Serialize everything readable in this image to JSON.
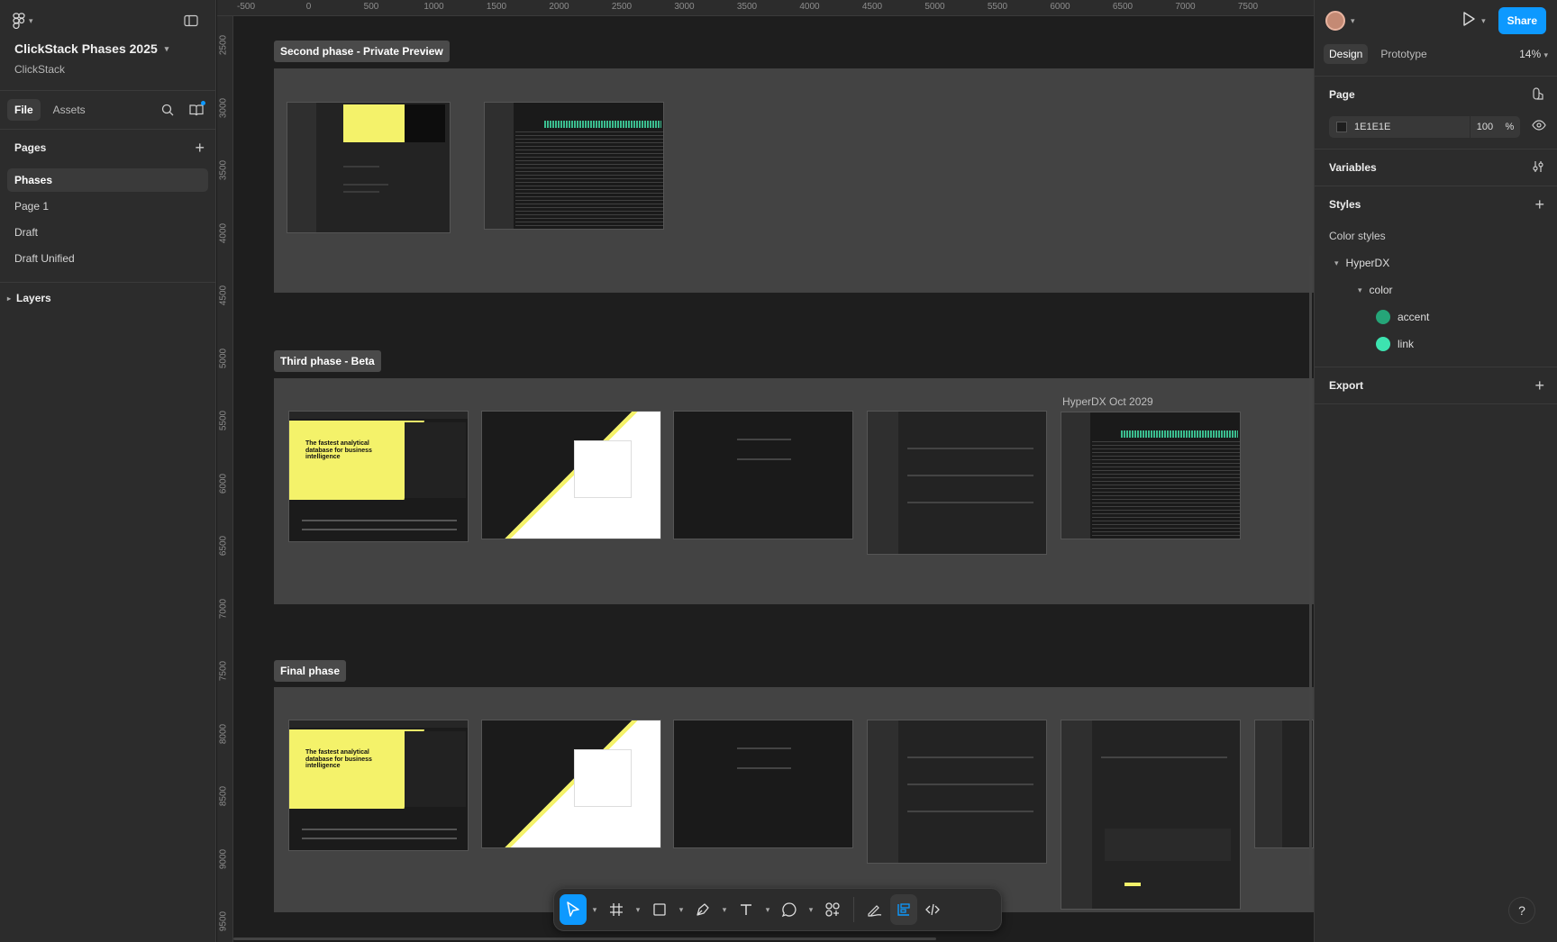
{
  "file": {
    "name": "ClickStack Phases 2025",
    "team": "ClickStack"
  },
  "left_tabs": {
    "file": "File",
    "assets": "Assets"
  },
  "pages": {
    "heading": "Pages",
    "items": [
      "Phases",
      "Page 1",
      "Draft",
      "Draft Unified"
    ],
    "selected": "Phases"
  },
  "layers_label": "Layers",
  "ruler": {
    "x_ticks": [
      "-500",
      "0",
      "500",
      "1000",
      "1500",
      "2000",
      "2500",
      "3000",
      "3500",
      "4000",
      "4500",
      "5000",
      "5500",
      "6000",
      "6500",
      "7000",
      "7500"
    ],
    "y_ticks": [
      "2500",
      "3000",
      "3500",
      "4000",
      "4500",
      "5000",
      "5500",
      "6000",
      "6500",
      "7000",
      "7500",
      "8000",
      "8500",
      "9000",
      "9500"
    ]
  },
  "canvas": {
    "sections": [
      {
        "label": "Second phase - Private Preview"
      },
      {
        "label": "Third phase - Beta"
      },
      {
        "label": "Final phase"
      }
    ],
    "frame_caption": "HyperDX Oct 2029",
    "landing_headline": "The fastest analytical database for business intelligence"
  },
  "toolbar": {
    "tools": [
      "move-tool",
      "frame-tool",
      "shape-tool",
      "pen-tool",
      "text-tool",
      "comment-tool",
      "actions-tool",
      "draw-mode",
      "design-mode",
      "dev-mode"
    ],
    "active": "move-tool"
  },
  "right": {
    "share_label": "Share",
    "tabs": {
      "design": "Design",
      "prototype": "Prototype"
    },
    "zoom": "14%",
    "page_heading": "Page",
    "page_fill_hex": "1E1E1E",
    "page_fill_opacity": "100",
    "page_fill_unit": "%",
    "variables_heading": "Variables",
    "styles_heading": "Styles",
    "color_styles_label": "Color styles",
    "style_group": "HyperDX",
    "style_subgroup": "color",
    "styles": [
      {
        "name": "accent",
        "color": "#25a578"
      },
      {
        "name": "link",
        "color": "#3de3b0"
      }
    ],
    "export_heading": "Export"
  },
  "colors": {
    "accent_blue": "#0d99ff",
    "canvas_bg": "#1e1e1e",
    "brand_yellow": "#f4f26a"
  }
}
